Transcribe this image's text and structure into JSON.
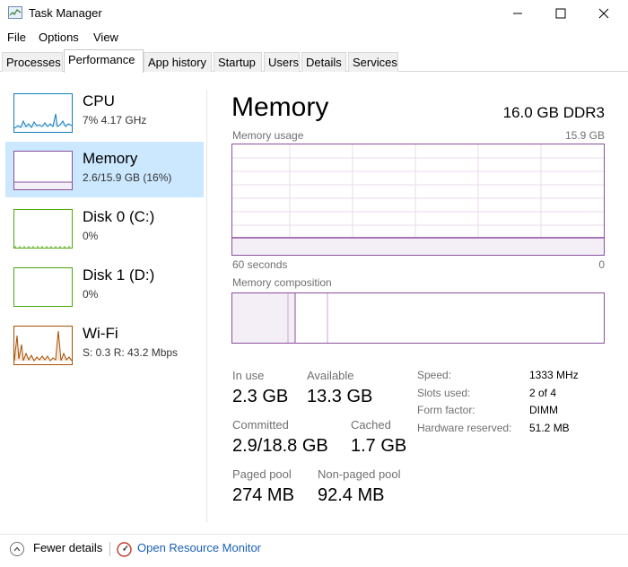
{
  "window": {
    "title": "Task Manager"
  },
  "menu": [
    "File",
    "Options",
    "View"
  ],
  "tabs": [
    "Processes",
    "Performance",
    "App history",
    "Startup",
    "Users",
    "Details",
    "Services"
  ],
  "active_tab": "Performance",
  "sidebar": [
    {
      "title": "CPU",
      "subtitle": "7%  4.17 GHz"
    },
    {
      "title": "Memory",
      "subtitle": "2.6/15.9 GB (16%)"
    },
    {
      "title": "Disk 0 (C:)",
      "subtitle": "0%"
    },
    {
      "title": "Disk 1 (D:)",
      "subtitle": "0%"
    },
    {
      "title": "Wi-Fi",
      "subtitle": "S: 0.3  R: 43.2 Mbps"
    }
  ],
  "main": {
    "title": "Memory",
    "spec": "16.0 GB DDR3",
    "usage_label": "Memory usage",
    "usage_max": "15.9 GB",
    "time_left": "60 seconds",
    "time_right": "0",
    "composition_label": "Memory composition",
    "usage_level": 0.16
  },
  "stats": {
    "in_use_label": "In use",
    "in_use": "2.3 GB",
    "available_label": "Available",
    "available": "13.3 GB",
    "committed_label": "Committed",
    "committed": "2.9/18.8 GB",
    "cached_label": "Cached",
    "cached": "1.7 GB",
    "paged_label": "Paged pool",
    "paged": "274 MB",
    "nonpaged_label": "Non-paged pool",
    "nonpaged": "92.4 MB"
  },
  "specs": {
    "speed_label": "Speed:",
    "speed": "1333 MHz",
    "slots_label": "Slots used:",
    "slots": "2 of 4",
    "form_label": "Form factor:",
    "form": "DIMM",
    "hw_label": "Hardware reserved:",
    "hw": "51.2 MB"
  },
  "footer": {
    "fewer": "Fewer details",
    "resmon": "Open Resource Monitor"
  },
  "colors": {
    "memory": "#8b4f9e",
    "cpu": "#117dbb",
    "disk": "#4da60c",
    "wifi": "#a74f01",
    "selected": "#cce8ff"
  }
}
